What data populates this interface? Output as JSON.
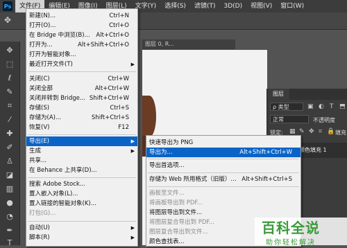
{
  "menubar": {
    "logo": "Ps",
    "items": [
      "文件(F)",
      "编辑(E)",
      "图像(I)",
      "图层(L)",
      "文字(Y)",
      "选择(S)",
      "滤镜(T)",
      "3D(D)",
      "视图(V)",
      "窗口(W)"
    ]
  },
  "document": {
    "tab_label": "图层 0, R..."
  },
  "file_menu": {
    "items": [
      {
        "label": "新建(N)...",
        "shortcut": "Ctrl+N"
      },
      {
        "label": "打开(O)...",
        "shortcut": "Ctrl+O"
      },
      {
        "label": "在 Bridge 中浏览(B)...",
        "shortcut": "Alt+Ctrl+O"
      },
      {
        "label": "打开为...",
        "shortcut": "Alt+Shift+Ctrl+O"
      },
      {
        "label": "打开为智能对象...",
        "shortcut": ""
      },
      {
        "label": "最近打开文件(T)",
        "shortcut": ""
      },
      {
        "label": "关闭(C)",
        "shortcut": "Ctrl+W"
      },
      {
        "label": "关闭全部",
        "shortcut": "Alt+Ctrl+W"
      },
      {
        "label": "关闭并转到 Bridge...",
        "shortcut": "Shift+Ctrl+W"
      },
      {
        "label": "存储(S)",
        "shortcut": "Ctrl+S"
      },
      {
        "label": "存储为(A)...",
        "shortcut": "Shift+Ctrl+S"
      },
      {
        "label": "恢复(V)",
        "shortcut": "F12"
      },
      {
        "label": "导出(E)",
        "shortcut": ""
      },
      {
        "label": "生成",
        "shortcut": ""
      },
      {
        "label": "共享...",
        "shortcut": ""
      },
      {
        "label": "在 Behance 上共享(D)...",
        "shortcut": ""
      },
      {
        "label": "搜索 Adobe Stock...",
        "shortcut": ""
      },
      {
        "label": "置入嵌入对象(L)...",
        "shortcut": ""
      },
      {
        "label": "置入链接的智能对象(K)...",
        "shortcut": ""
      },
      {
        "label": "打包(G)...",
        "shortcut": ""
      },
      {
        "label": "自动(U)",
        "shortcut": ""
      },
      {
        "label": "脚本(R)",
        "shortcut": ""
      }
    ]
  },
  "export_menu": {
    "items": [
      {
        "label": "快速导出为 PNG",
        "shortcut": ""
      },
      {
        "label": "导出为...",
        "shortcut": "Alt+Shift+Ctrl+W"
      },
      {
        "label": "导出首选项...",
        "shortcut": ""
      },
      {
        "label": "存储为 Web 所用格式（旧版）...",
        "shortcut": "Alt+Shift+Ctrl+S"
      },
      {
        "label": "画板至文件...",
        "shortcut": ""
      },
      {
        "label": "将画板导出到 PDF...",
        "shortcut": ""
      },
      {
        "label": "将图层导出到文件...",
        "shortcut": ""
      },
      {
        "label": "将图层复合导出到 PDF...",
        "shortcut": ""
      },
      {
        "label": "图层复合导出到文件...",
        "shortcut": ""
      },
      {
        "label": "颜色查找表...",
        "shortcut": ""
      }
    ]
  },
  "layers_panel": {
    "tab": "图层",
    "filter": "ρ 类型",
    "blend_mode": "正常",
    "opacity_label": "不透明度",
    "lock_label": "锁定:",
    "fill_label": "填充",
    "layer_name": "颜色填充 1"
  },
  "watermark": {
    "title": "百科全说",
    "subtitle": "助你轻松解决"
  }
}
